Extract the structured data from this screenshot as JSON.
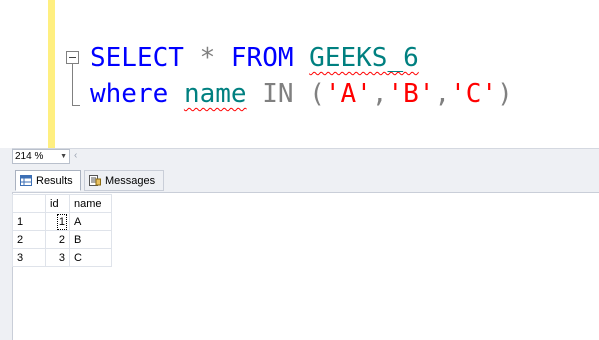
{
  "editor": {
    "line1": {
      "select": "SELECT",
      "star": "*",
      "from": "FROM",
      "table": "GEEKS_6"
    },
    "line2": {
      "where": "where",
      "column": "name",
      "in": "IN",
      "open": "(",
      "v1": "'A'",
      "comma1": ",",
      "v2": "'B'",
      "comma2": ",",
      "v3": "'C'",
      "close": ")"
    }
  },
  "zoom": {
    "value": "214 %"
  },
  "tabs": [
    {
      "label": "Results",
      "icon": "grid-icon"
    },
    {
      "label": "Messages",
      "icon": "messages-icon"
    }
  ],
  "grid": {
    "columns": [
      "id",
      "name"
    ],
    "rows": [
      {
        "num": "1",
        "id": "1",
        "name": "A"
      },
      {
        "num": "2",
        "id": "2",
        "name": "B"
      },
      {
        "num": "3",
        "id": "3",
        "name": "C"
      }
    ]
  },
  "colors": {
    "keyword": "#0000ff",
    "identifier": "#008080",
    "string": "#ff0000",
    "operator": "#808080",
    "marker": "#ffef80"
  }
}
